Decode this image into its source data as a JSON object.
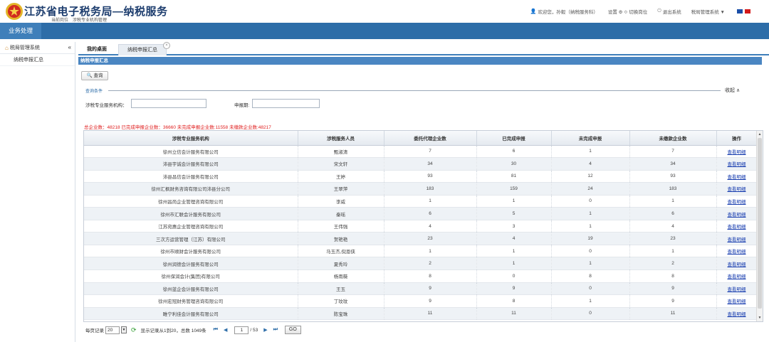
{
  "header": {
    "title": "江苏省电子税务局—纳税服务",
    "subtitle": "当前岗位　涉税专业机构管理",
    "links": [
      {
        "icon": "user-icon",
        "label": "欢迎您，孙毅（纳税服务科）"
      },
      {
        "icon": "gear-icon",
        "label": "设置 ⚙ ⟐ 切换岗位"
      },
      {
        "icon": "power-icon",
        "label": "退出系统"
      },
      {
        "icon": "chevron-down-icon",
        "label": "税局管理系统 ▼"
      }
    ],
    "flag_colors": [
      "#1a4ea8",
      "#d31a1a"
    ]
  },
  "nav": {
    "business": "业务处理"
  },
  "sidebar": {
    "root": "税局管理系统",
    "collapse": "«",
    "items": [
      {
        "label": "纳税申报汇总"
      }
    ]
  },
  "tabs": {
    "home": "我的桌面",
    "active": "纳税申报汇总",
    "close": "×"
  },
  "panel": {
    "title": "纳税申报汇总"
  },
  "toolbar": {
    "query": "🔍 查询"
  },
  "filters": {
    "section": "查询条件",
    "collapse": "收起 ∧",
    "org_label": "涉税专业服务机构：",
    "org_value": "",
    "period_label": "申报期:",
    "period_value": ""
  },
  "summary": "总企业数：48218 已完成申报企业数：36660 未完成申报企业数:11558 未缴款企业数:48217",
  "table": {
    "columns": [
      "涉税专业服务机构",
      "涉税服务人员",
      "委托代理企业数",
      "已完成申报",
      "未完成申报",
      "未缴款企业数",
      "操作"
    ],
    "rows": [
      [
        "徐州立信会计服务有限公司",
        "甄淑清",
        "7",
        "6",
        "1",
        "7",
        "查看明细"
      ],
      [
        "沛县宇诚会计服务有限公司",
        "宋文轩",
        "34",
        "30",
        "4",
        "34",
        "查看明细"
      ],
      [
        "沛县昌信会计服务有限公司",
        "王婷",
        "93",
        "81",
        "12",
        "93",
        "查看明细"
      ],
      [
        "徐州汇枫财务咨询有限公司沛县分公司",
        "王翠萍",
        "183",
        "159",
        "24",
        "183",
        "查看明细"
      ],
      [
        "徐州昌尚企业管理咨询有限公司",
        "李威",
        "1",
        "1",
        "0",
        "1",
        "查看明细"
      ],
      [
        "徐州市汇联会计服务有限公司",
        "秦瑶",
        "6",
        "5",
        "1",
        "6",
        "查看明细"
      ],
      [
        "江苏宛惠企业管理咨询有限公司",
        "王伟强",
        "4",
        "3",
        "1",
        "4",
        "查看明细"
      ],
      [
        "三次方运营管理（江苏）有限公司",
        "贺艳艳",
        "23",
        "4",
        "19",
        "23",
        "查看明细"
      ],
      [
        "徐州市顺财会计服务有限公司",
        "马玉杰,倪恩侠",
        "1",
        "1",
        "0",
        "1",
        "查看明细"
      ],
      [
        "徐州润德会计服务有限公司",
        "夏秀玲",
        "2",
        "1",
        "1",
        "2",
        "查看明细"
      ],
      [
        "徐州保润会计(集团)有限公司",
        "杨雨薇",
        "8",
        "0",
        "8",
        "8",
        "查看明细"
      ],
      [
        "徐州蓝企会计服务有限公司",
        "王玉",
        "9",
        "9",
        "0",
        "9",
        "查看明细"
      ],
      [
        "徐州宏冠财务管理咨询有限公司",
        "丁玟玟",
        "9",
        "8",
        "1",
        "9",
        "查看明细"
      ],
      [
        "睢宁利佳会计服务有限公司",
        "陈宝珠",
        "11",
        "11",
        "0",
        "11",
        "查看明细"
      ]
    ]
  },
  "pager": {
    "per_page_label": "每页记录",
    "per_page": "20",
    "records": "显示记录从1到20，总数 1049条",
    "first": "⏮",
    "prev": "◀",
    "page": "1",
    "total_pages": "/ 53",
    "next": "▶",
    "last": "⏭",
    "go": "GO"
  }
}
